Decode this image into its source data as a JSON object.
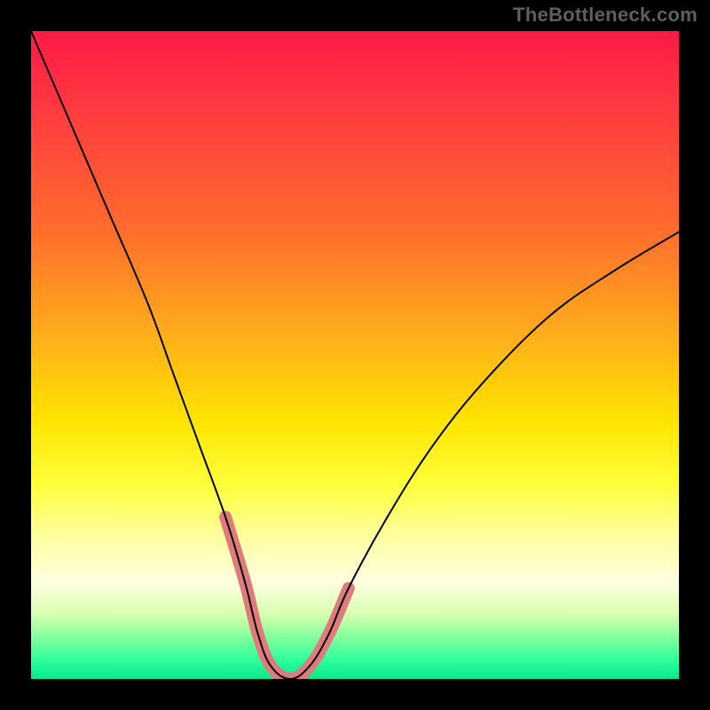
{
  "watermark": "TheBottleneck.com",
  "colors": {
    "background": "#000000",
    "curve": "#000000",
    "marker": "#e07b7b",
    "gradient_top": "#ff1a46",
    "gradient_bottom": "#06e98d"
  },
  "chart_data": {
    "type": "line",
    "title": "",
    "xlabel": "",
    "ylabel": "",
    "xlim": [
      0,
      100
    ],
    "ylim": [
      0,
      100
    ],
    "grid": false,
    "series": [
      {
        "name": "bottleneck-curve",
        "x": [
          0,
          6,
          12,
          18,
          22,
          26,
          30,
          33,
          35,
          37,
          40,
          43,
          46,
          49,
          55,
          62,
          70,
          80,
          90,
          100
        ],
        "values": [
          100,
          86,
          72,
          58,
          47,
          36,
          25,
          15,
          7,
          2,
          0,
          2,
          7,
          14,
          25,
          36,
          46,
          56,
          63,
          69
        ]
      }
    ],
    "markers": {
      "name": "highlight-segment",
      "x": [
        30,
        33,
        35,
        37,
        40,
        43,
        46,
        49
      ],
      "values": [
        25,
        15,
        7,
        2,
        0,
        2,
        7,
        14
      ]
    }
  }
}
